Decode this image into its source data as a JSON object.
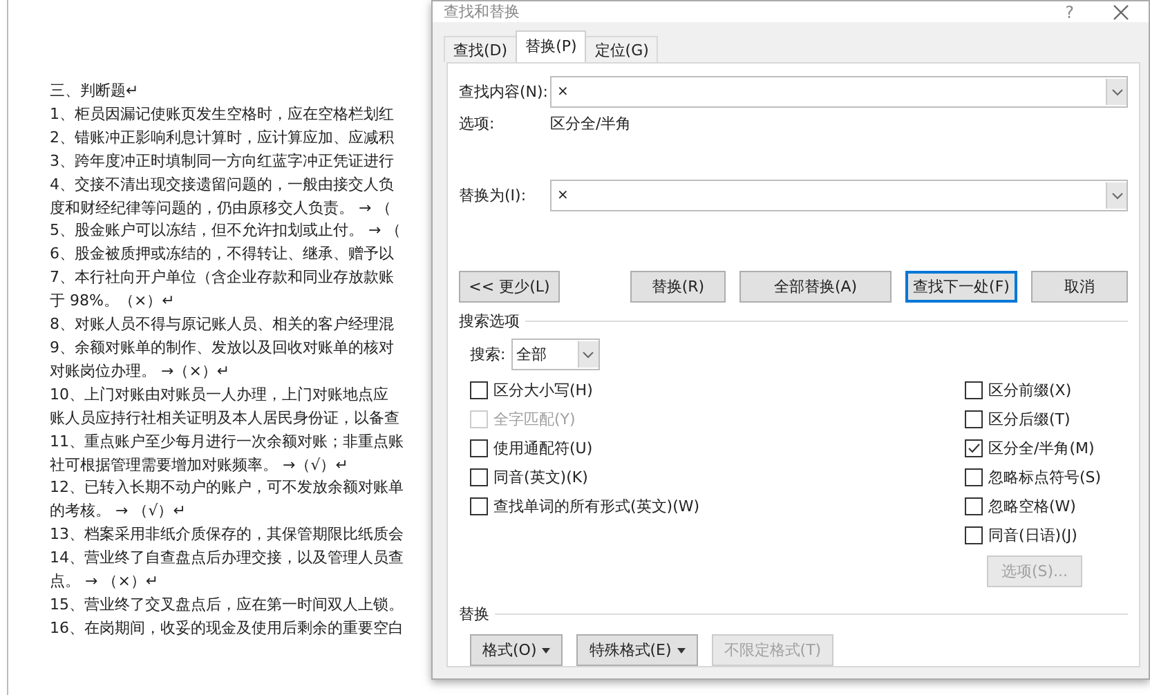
{
  "document": {
    "lines": [
      "三、判断题↵",
      "1、柜员因漏记使账页发生空格时，应在空格栏划红",
      "2、错账冲正影响利息计算时，应计算应加、应减积",
      "3、跨年度冲正时填制同一方向红蓝字冲正凭证进行",
      "4、交接不清出现交接遗留问题的，一般由接交人负",
      "度和财经纪律等问题的，仍由原移交人负责。 → （",
      "5、股金账户可以冻结，但不允许扣划或止付。 → （",
      "6、股金被质押或冻结的，不得转让、继承、赠予以",
      "7、本行社向开户单位（含企业存款和同业存放款账",
      "于 98%。（×）↵",
      "8、对账人员不得与原记账人员、相关的客户经理混",
      "9、余额对账单的制作、发放以及回收对账单的核对",
      "对账岗位办理。 →（×）↵",
      "10、上门对账由对账员一人办理，上门对账地点应",
      "账人员应持行社相关证明及本人居民身份证，以备查",
      "11、重点账户至少每月进行一次余额对账；非重点账",
      "社可根据管理需要增加对账频率。 →（√）↵",
      "12、已转入长期不动户的账户，可不发放余额对账单",
      "的考核。 → （√）↵",
      "13、档案采用非纸介质保存的，其保管期限比纸质会",
      "14、营业终了自查盘点后办理交接，以及管理人员查",
      "点。 → （×）↵",
      "15、营业终了交叉盘点后，应在第一时间双人上锁。",
      "16、在岗期间，收妥的现金及使用后剩余的重要空白"
    ]
  },
  "dialog": {
    "title": "查找和替换",
    "help": "?",
    "tabs": [
      {
        "label": "查找(D)",
        "selected": false
      },
      {
        "label": "替换(P)",
        "selected": true
      },
      {
        "label": "定位(G)",
        "selected": false
      }
    ],
    "find": {
      "label": "查找内容(N):",
      "value": "×"
    },
    "options": {
      "label": "选项:",
      "value": "区分全/半角"
    },
    "replace": {
      "label": "替换为(I):",
      "value": "×"
    },
    "buttons": [
      {
        "label": "<< 更少(L)",
        "focused": false
      },
      {
        "label": "替换(R)",
        "focused": false
      },
      {
        "label": "全部替换(A)",
        "focused": false
      },
      {
        "label": "查找下一处(F)",
        "focused": true
      },
      {
        "label": "取消",
        "focused": false
      }
    ],
    "search_options": {
      "title": "搜索选项",
      "search_label": "搜索:",
      "search_value": "全部",
      "left": [
        {
          "label": "区分大小写(H)",
          "checked": false,
          "disabled": false
        },
        {
          "label": "全字匹配(Y)",
          "checked": false,
          "disabled": true
        },
        {
          "label": "使用通配符(U)",
          "checked": false,
          "disabled": false
        },
        {
          "label": "同音(英文)(K)",
          "checked": false,
          "disabled": false
        },
        {
          "label": "查找单词的所有形式(英文)(W)",
          "checked": false,
          "disabled": false
        }
      ],
      "right": [
        {
          "label": "区分前缀(X)",
          "checked": false,
          "disabled": false
        },
        {
          "label": "区分后缀(T)",
          "checked": false,
          "disabled": false
        },
        {
          "label": "区分全/半角(M)",
          "checked": true,
          "disabled": false
        },
        {
          "label": "忽略标点符号(S)",
          "checked": false,
          "disabled": false
        },
        {
          "label": "忽略空格(W)",
          "checked": false,
          "disabled": false
        },
        {
          "label": "同音(日语)(J)",
          "checked": false,
          "disabled": false
        }
      ],
      "options_button": {
        "label": "选项(S)...",
        "disabled": true
      }
    },
    "replace_section": {
      "title": "替换",
      "buttons": [
        {
          "label": "格式(O)",
          "dropdown": true,
          "disabled": false
        },
        {
          "label": "特殊格式(E)",
          "dropdown": true,
          "disabled": false
        },
        {
          "label": "不限定格式(T)",
          "dropdown": false,
          "disabled": true
        }
      ]
    }
  }
}
